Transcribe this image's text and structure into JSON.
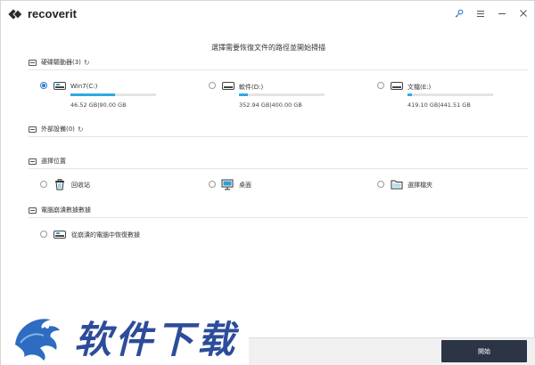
{
  "app": {
    "name": "recoverit"
  },
  "titlebar_icons": [
    "key-icon",
    "menu-icon",
    "minimize-icon",
    "close-icon"
  ],
  "main": {
    "title": "選擇需要恢復文件的路徑並開始掃描"
  },
  "sections": {
    "hard_drives": {
      "label": "硬碟驅動器(3)"
    },
    "external": {
      "label": "外部設備(0)"
    },
    "location": {
      "label": "選擇位置"
    },
    "crashed": {
      "label": "電腦崩潰數據數據"
    }
  },
  "drives": [
    {
      "label": "Win7(C:)",
      "size": "46.52  GB|90.00  GB",
      "used_fraction": 0.52,
      "selected": true
    },
    {
      "label": "軟件(D:)",
      "size": "352.94  GB|400.00  GB",
      "used_fraction": 0.1,
      "selected": false
    },
    {
      "label": "文檔(E:)",
      "size": "419.10  GB|441.51  GB",
      "used_fraction": 0.05,
      "selected": false
    }
  ],
  "locations": [
    {
      "label": "回收站",
      "icon": "recycle-bin-icon"
    },
    {
      "label": "桌面",
      "icon": "desktop-icon"
    },
    {
      "label": "選擇檔夾",
      "icon": "folder-icon"
    }
  ],
  "crash_option": {
    "label": "從崩潰的電腦中恢復數據"
  },
  "footer": {
    "start_label": "開始"
  },
  "watermark": {
    "text": "软件下载"
  },
  "colors": {
    "accent": "#2fa9e0",
    "button": "#2c3546",
    "watermark": "#2d4c9a"
  }
}
